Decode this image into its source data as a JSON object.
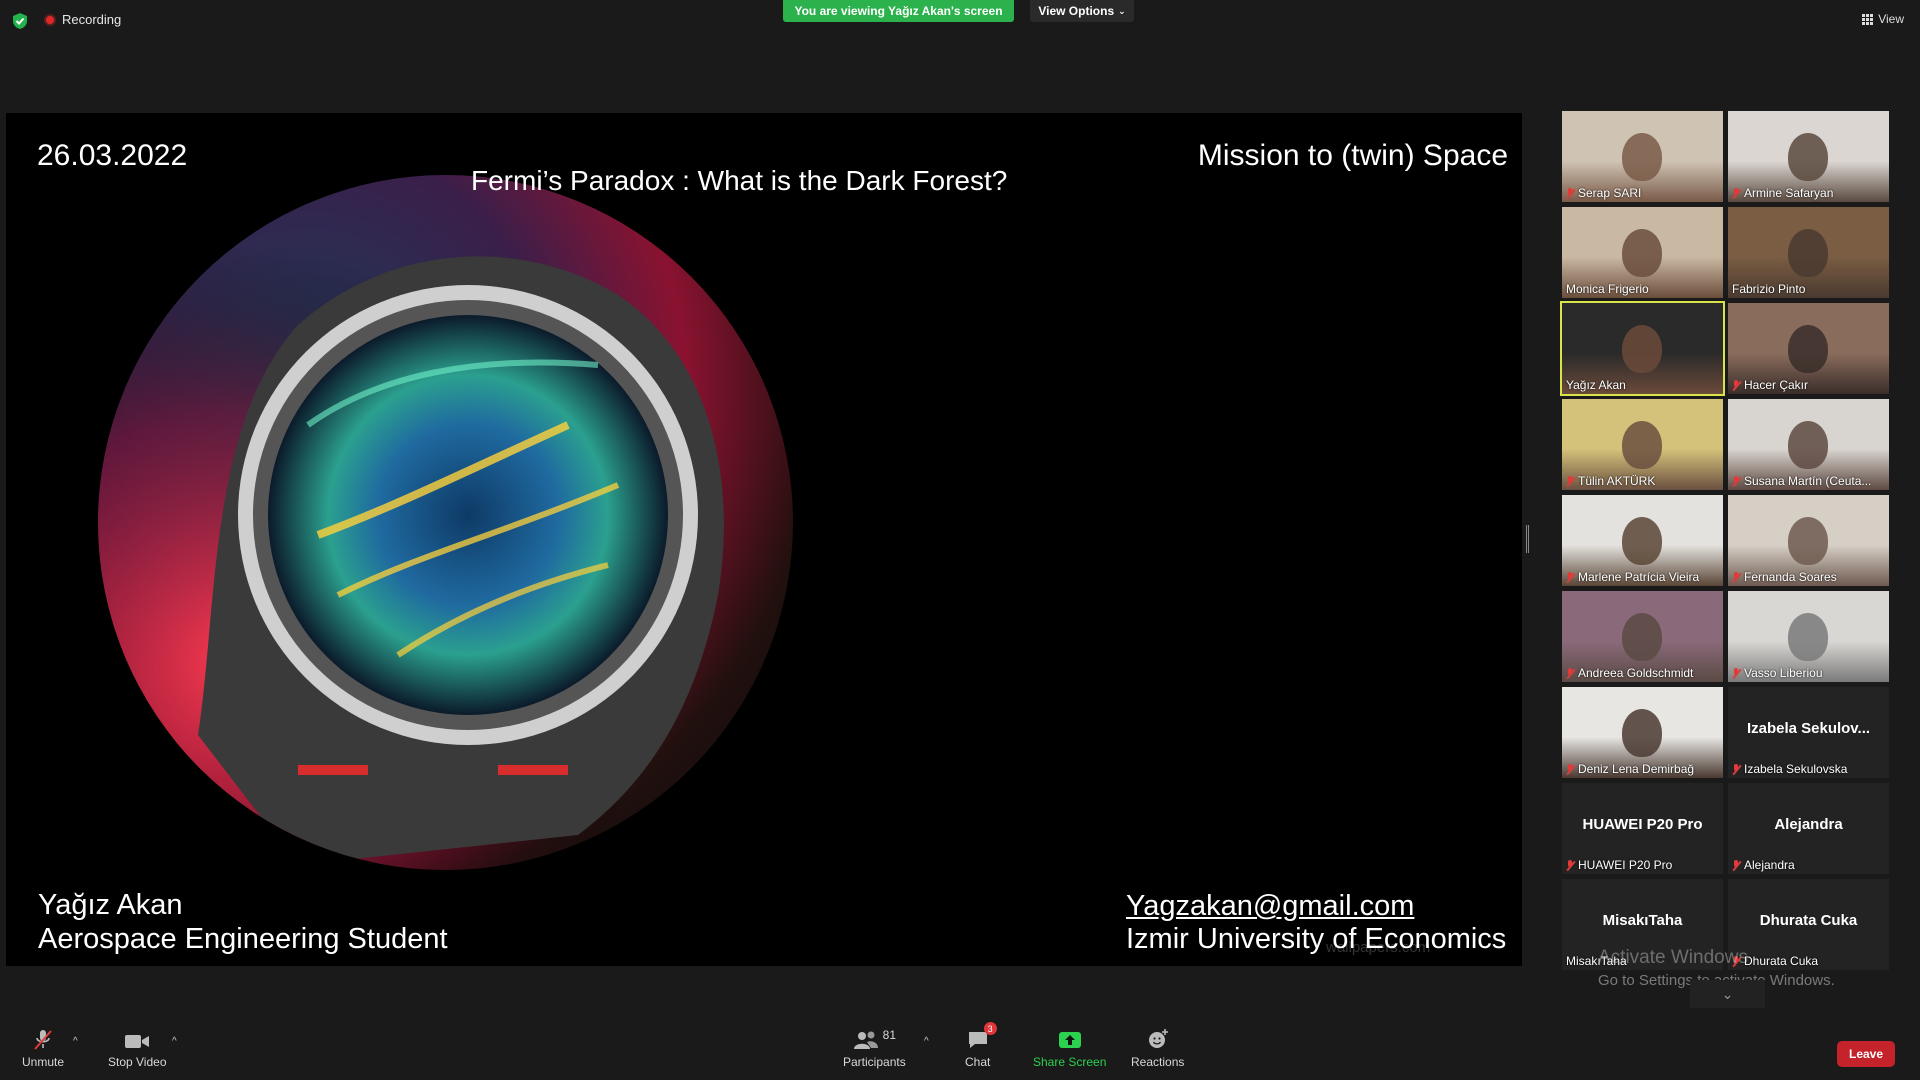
{
  "topbar": {
    "recording_label": "Recording",
    "viewing_banner": "You are viewing Yağız Akan's screen",
    "view_options_label": "View Options",
    "view_label": "View"
  },
  "slide": {
    "date": "26.03.2022",
    "title": "Fermi’s Paradox : What is the Dark Forest?",
    "mission": "Mission to (twin) Space",
    "presenter_name": "Yağız Akan",
    "presenter_role": "Aerospace Engineering Student",
    "email": "Yagzakan@gmail.com",
    "university": "Izmir University of Economics",
    "watermark": "wallpapers.com"
  },
  "participants_gallery": [
    {
      "name": "Serap SARI",
      "muted": true,
      "video": true,
      "active": false
    },
    {
      "name": "Armine Safaryan",
      "muted": true,
      "video": true,
      "active": false
    },
    {
      "name": "Monica Frigerio",
      "muted": false,
      "video": true,
      "active": false
    },
    {
      "name": "Fabrizio Pinto",
      "muted": false,
      "video": true,
      "active": false
    },
    {
      "name": "Yağız Akan",
      "muted": false,
      "video": true,
      "active": true
    },
    {
      "name": "Hacer Çakır",
      "muted": true,
      "video": true,
      "active": false
    },
    {
      "name": "Tülin AKTÜRK",
      "muted": true,
      "video": true,
      "active": false
    },
    {
      "name": "Susana Martín (Ceuta...",
      "muted": true,
      "video": true,
      "active": false
    },
    {
      "name": "Marlene Patrícia Vieira",
      "muted": true,
      "video": true,
      "active": false
    },
    {
      "name": "Fernanda Soares",
      "muted": true,
      "video": true,
      "active": false
    },
    {
      "name": "Andreea Goldschmidt",
      "muted": true,
      "video": true,
      "active": false
    },
    {
      "name": "Vasso Liberiou",
      "muted": true,
      "video": true,
      "active": false
    },
    {
      "name": "Deniz Lena Demirbağ",
      "muted": true,
      "video": true,
      "active": false
    },
    {
      "name": "Izabela Sekulovska",
      "muted": true,
      "video": false,
      "big": "Izabela  Sekulov...",
      "active": false
    },
    {
      "name": "HUAWEI P20 Pro",
      "muted": true,
      "video": false,
      "big": "HUAWEI P20 Pro",
      "active": false
    },
    {
      "name": "Alejandra",
      "muted": true,
      "video": false,
      "big": "Alejandra",
      "active": false
    },
    {
      "name": "MisakıTaha",
      "muted": false,
      "video": false,
      "big": "MisakıTaha",
      "active": false
    },
    {
      "name": "Dhurata Cuka",
      "muted": true,
      "video": false,
      "big": "Dhurata Cuka",
      "active": false
    }
  ],
  "windows_watermark": {
    "line1": "Activate Windows",
    "line2": "Go to Settings to activate Windows."
  },
  "toolbar": {
    "unmute_label": "Unmute",
    "stop_video_label": "Stop Video",
    "participants_label": "Participants",
    "participants_count": "81",
    "chat_label": "Chat",
    "chat_badge": "3",
    "share_screen_label": "Share Screen",
    "reactions_label": "Reactions",
    "leave_label": "Leave"
  },
  "colors": {
    "share_green": "#2bb24c",
    "leave_red": "#c4232c",
    "active_speaker": "#d9e34a"
  }
}
